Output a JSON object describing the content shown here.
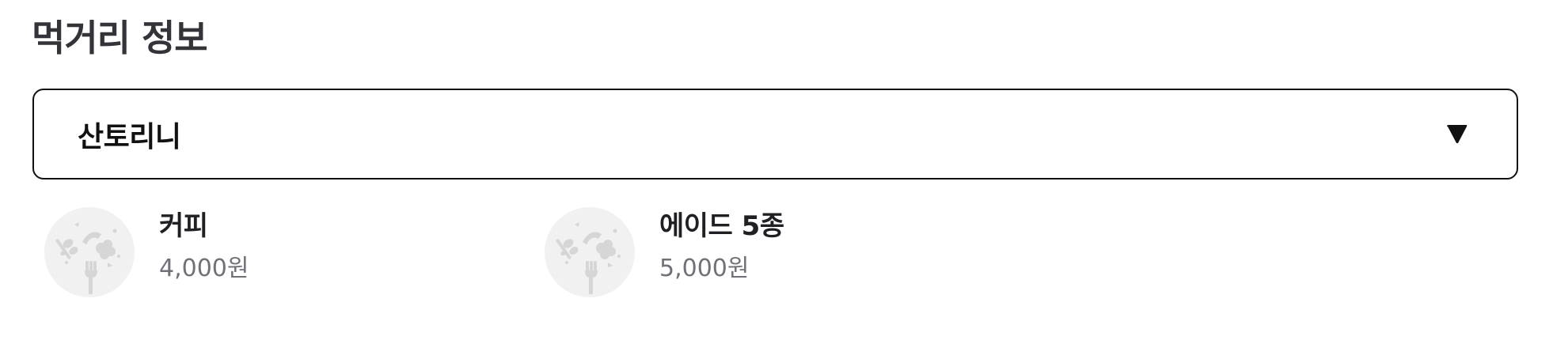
{
  "section": {
    "title": "먹거리 정보"
  },
  "dropdown": {
    "selected": "산토리니",
    "caret_icon": "caret-down-icon"
  },
  "menu": {
    "placeholder_icon": "food-placeholder-icon",
    "items": [
      {
        "name": "커피",
        "price": "4,000원"
      },
      {
        "name": "에이드 5종",
        "price": "5,000원"
      }
    ]
  },
  "colors": {
    "title": "#33333a",
    "text_primary": "#1f1f24",
    "text_secondary": "#707078",
    "border": "#111111",
    "thumb_bg": "#f1f1f1",
    "thumb_icon": "#d6d6d6"
  }
}
